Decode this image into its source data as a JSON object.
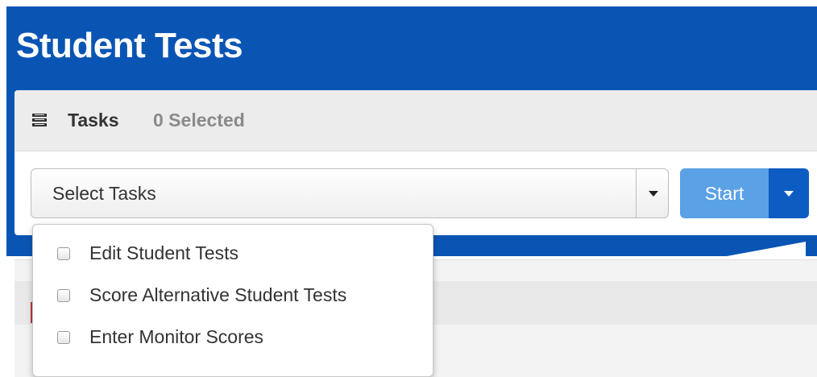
{
  "page": {
    "title": "Student Tests"
  },
  "tasks": {
    "heading": "Tasks",
    "selected_count": "0 Selected",
    "select_placeholder": "Select Tasks",
    "start_label": "Start",
    "options": [
      {
        "label": "Edit Student Tests",
        "checked": false
      },
      {
        "label": "Score Alternative Student Tests",
        "checked": false
      },
      {
        "label": "Enter Monitor Scores",
        "checked": false
      }
    ]
  },
  "icons": {
    "tasks_heading": "list-icon",
    "select_toggle": "caret-down-icon",
    "start_toggle": "caret-down-icon"
  },
  "colors": {
    "header_band": "#0a55b4",
    "start_button": "#5aa1e6",
    "start_dropdown": "#0d5cc2"
  }
}
